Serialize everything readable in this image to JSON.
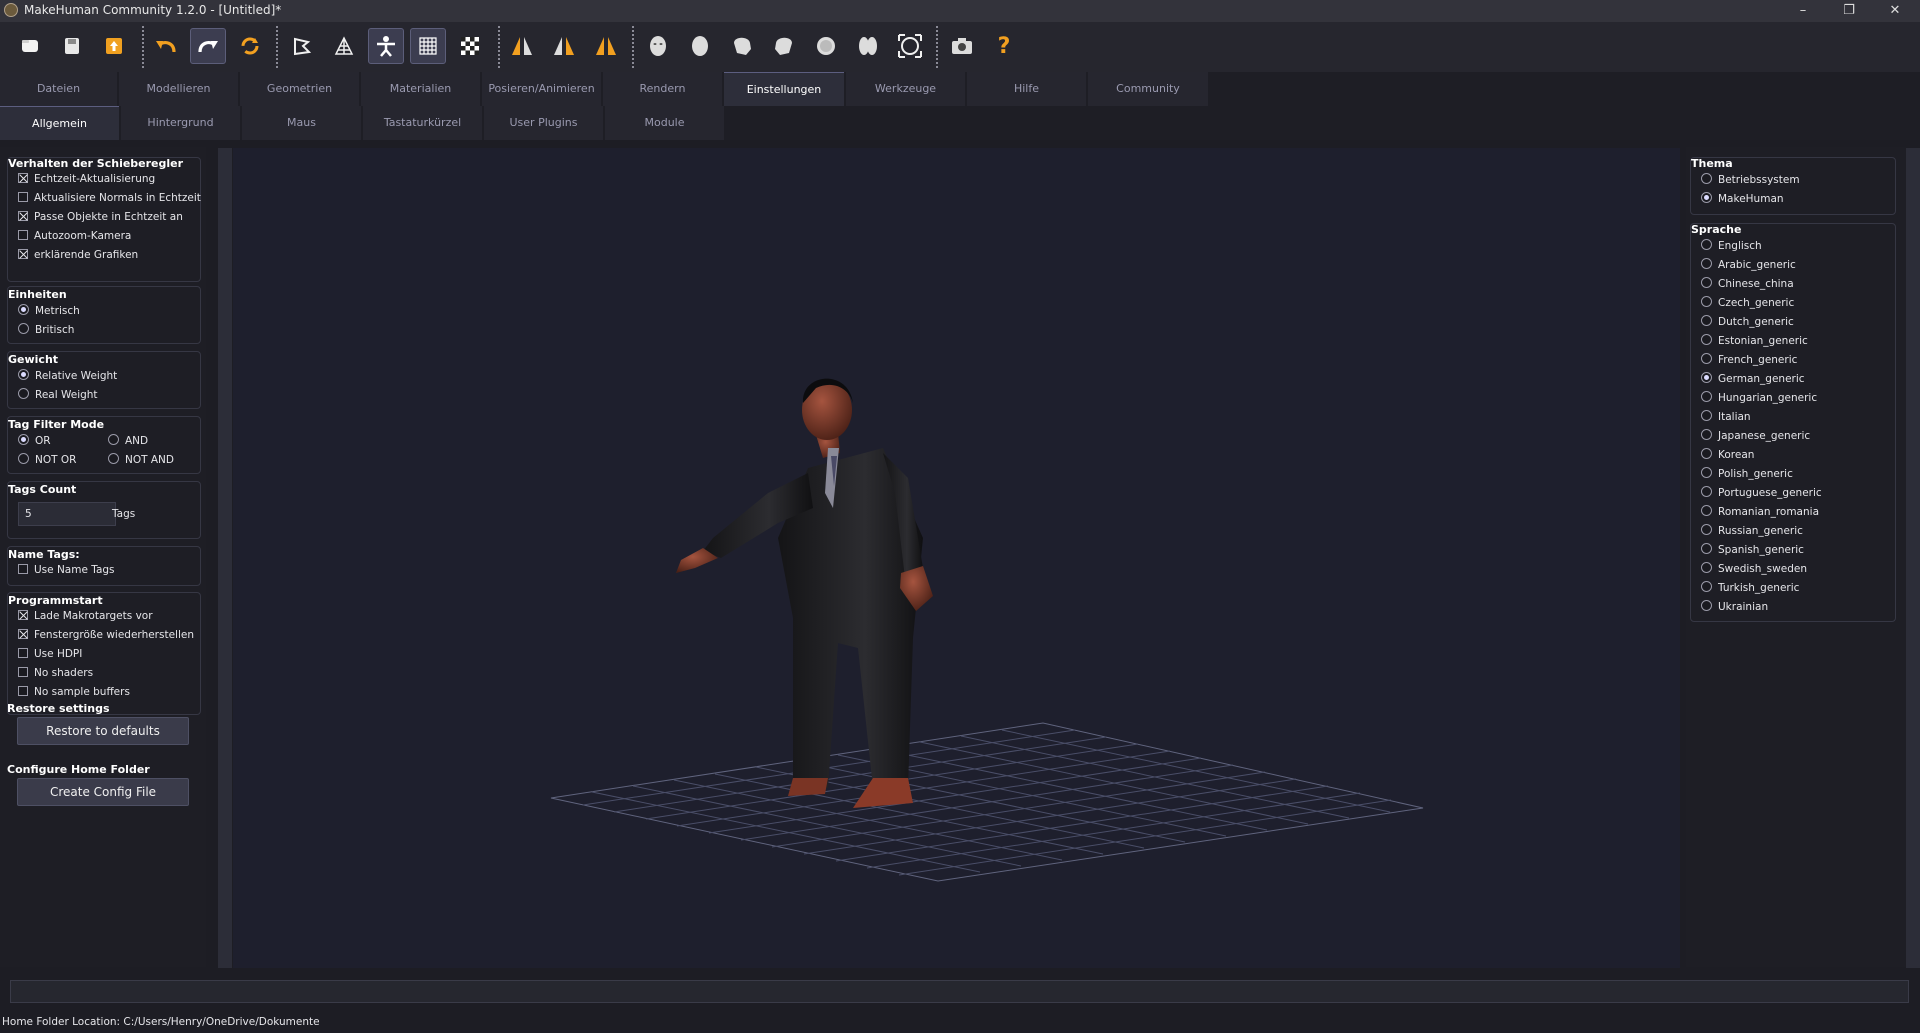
{
  "window": {
    "title": "MakeHuman Community 1.2.0 - [Untitled]*",
    "controls": {
      "minimize": "–",
      "maximize": "❐",
      "close": "✕"
    }
  },
  "toolbar": {
    "icons": [
      "folder-icon",
      "save-icon",
      "export-icon",
      "undo-icon",
      "redo-icon",
      "reset-icon",
      "smooth-icon",
      "wireframe-icon",
      "pose-icon",
      "grid-icon",
      "checker-icon",
      "front-view-icon",
      "side-view-icon",
      "back-view-icon",
      "face-icon",
      "head-icon",
      "left-icon",
      "right-icon",
      "top-icon",
      "bottom-icon",
      "reset-camera-icon",
      "screenshot-icon",
      "help-icon"
    ],
    "help_label": "?"
  },
  "tabs": [
    "Dateien",
    "Modellieren",
    "Geometrien",
    "Materialien",
    "Posieren/Animieren",
    "Rendern",
    "Einstellungen",
    "Werkzeuge",
    "Hilfe",
    "Community"
  ],
  "subtabs": [
    "Allgemein",
    "Hintergrund",
    "Maus",
    "Tastaturkürzel",
    "User Plugins",
    "Module"
  ],
  "left": {
    "slider": {
      "title": "Verhalten der Schieberegler",
      "items": [
        {
          "label": "Echtzeit-Aktualisierung",
          "checked": true
        },
        {
          "label": "Aktualisiere Normals in Echtzeit",
          "checked": false
        },
        {
          "label": "Passe Objekte in Echtzeit an",
          "checked": true
        },
        {
          "label": "Autozoom-Kamera",
          "checked": false
        },
        {
          "label": "erklärende Grafiken",
          "checked": true
        }
      ]
    },
    "units": {
      "title": "Einheiten",
      "items": [
        {
          "label": "Metrisch",
          "checked": true
        },
        {
          "label": "Britisch",
          "checked": false
        }
      ]
    },
    "weight": {
      "title": "Gewicht",
      "items": [
        {
          "label": "Relative Weight",
          "checked": true
        },
        {
          "label": "Real Weight",
          "checked": false
        }
      ]
    },
    "tagfilter": {
      "title": "Tag Filter Mode",
      "items": [
        {
          "label": "OR",
          "checked": true
        },
        {
          "label": "AND",
          "checked": false
        },
        {
          "label": "NOT OR",
          "checked": false
        },
        {
          "label": "NOT AND",
          "checked": false
        }
      ]
    },
    "tagscount": {
      "title": "Tags Count",
      "value": "5",
      "unit": "Tags"
    },
    "nametags": {
      "title": "Name Tags:",
      "items": [
        {
          "label": "Use Name Tags",
          "checked": false
        }
      ]
    },
    "startup": {
      "title": "Programmstart",
      "items": [
        {
          "label": "Lade Makrotargets vor",
          "checked": true
        },
        {
          "label": "Fenstergröße wiederherstellen",
          "checked": true
        },
        {
          "label": "Use HDPI",
          "checked": false
        },
        {
          "label": "No shaders",
          "checked": false
        },
        {
          "label": "No sample buffers",
          "checked": false
        }
      ]
    },
    "restore": {
      "title": "Restore settings",
      "button": "Restore to defaults"
    },
    "homefolder": {
      "title": "Configure Home Folder",
      "button": "Create Config File"
    }
  },
  "right": {
    "theme": {
      "title": "Thema",
      "items": [
        {
          "label": "Betriebssystem",
          "checked": false
        },
        {
          "label": "MakeHuman",
          "checked": true
        }
      ]
    },
    "language": {
      "title": "Sprache",
      "items": [
        {
          "label": "Englisch",
          "checked": false
        },
        {
          "label": "Arabic_generic",
          "checked": false
        },
        {
          "label": "Chinese_china",
          "checked": false
        },
        {
          "label": "Czech_generic",
          "checked": false
        },
        {
          "label": "Dutch_generic",
          "checked": false
        },
        {
          "label": "Estonian_generic",
          "checked": false
        },
        {
          "label": "French_generic",
          "checked": false
        },
        {
          "label": "German_generic",
          "checked": true
        },
        {
          "label": "Hungarian_generic",
          "checked": false
        },
        {
          "label": "Italian",
          "checked": false
        },
        {
          "label": "Japanese_generic",
          "checked": false
        },
        {
          "label": "Korean",
          "checked": false
        },
        {
          "label": "Polish_generic",
          "checked": false
        },
        {
          "label": "Portuguese_generic",
          "checked": false
        },
        {
          "label": "Romanian_romania",
          "checked": false
        },
        {
          "label": "Russian_generic",
          "checked": false
        },
        {
          "label": "Spanish_generic",
          "checked": false
        },
        {
          "label": "Swedish_sweden",
          "checked": false
        },
        {
          "label": "Turkish_generic",
          "checked": false
        },
        {
          "label": "Ukrainian",
          "checked": false
        }
      ]
    }
  },
  "status": {
    "text": "Home Folder Location: C:/Users/Henry/OneDrive/Dokumente"
  }
}
